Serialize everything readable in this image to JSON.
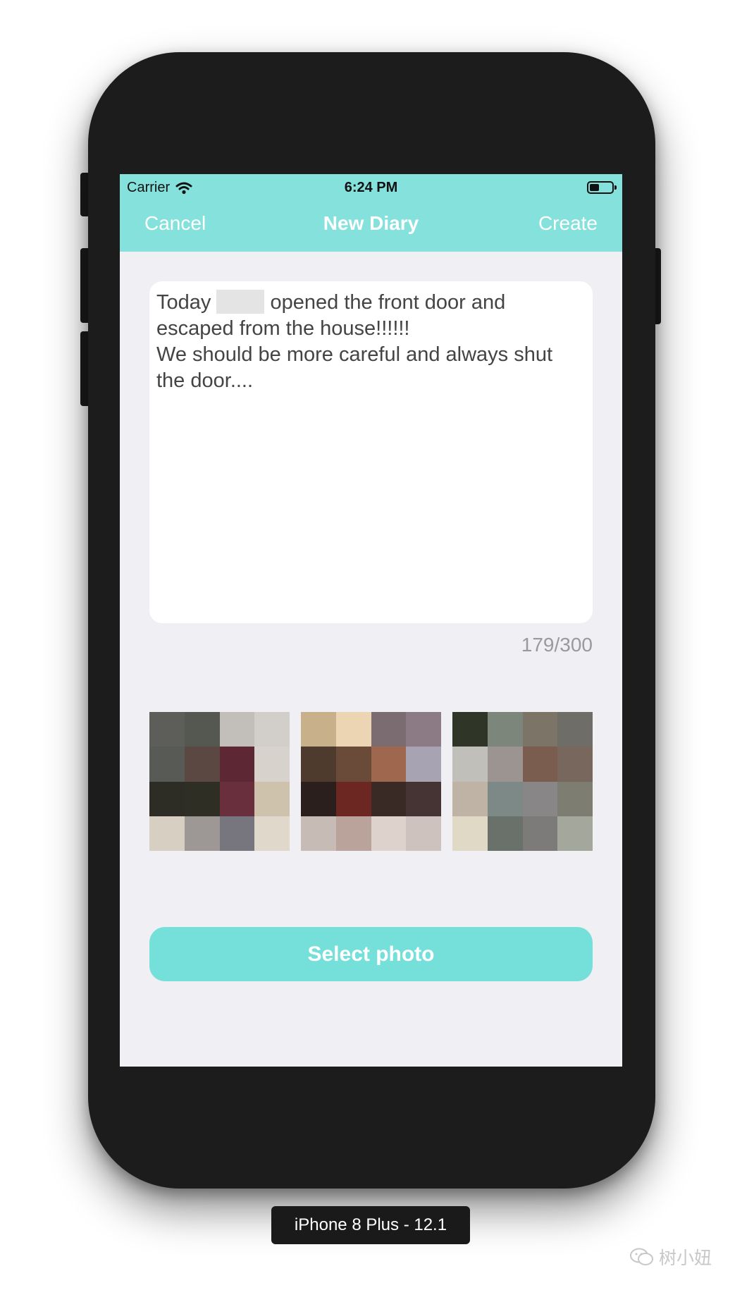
{
  "status_bar": {
    "carrier": "Carrier",
    "time": "6:24 PM"
  },
  "nav": {
    "cancel_label": "Cancel",
    "title": "New Diary",
    "create_label": "Create"
  },
  "editor": {
    "text_before": "Today ",
    "text_after": " opened the front door and escaped from the house!!!!!!\nWe should be more careful and always shut the door....",
    "counter": "179/300"
  },
  "photos": [
    {
      "colors": [
        "#5d5d5a",
        "#555851",
        "#c2bfba",
        "#d2cfca",
        "#575a55",
        "#5b4843",
        "#5e2734",
        "#d8d2cc",
        "#2e2d25",
        "#2f2e24",
        "#6a2f3d",
        "#cfc2ac",
        "#d7cfc2",
        "#9d9896",
        "#77767f",
        "#e0d8cb"
      ]
    },
    {
      "colors": [
        "#c8b08b",
        "#ebd5b3",
        "#7b6c72",
        "#8c7b85",
        "#4e3b2d",
        "#6a4b3a",
        "#a0674f",
        "#a7a3b2",
        "#2b1f1d",
        "#6c2723",
        "#3a2a26",
        "#463434",
        "#c6bbb5",
        "#b9a39b",
        "#ddd3cc",
        "#cdc2bd"
      ]
    },
    {
      "colors": [
        "#2f3527",
        "#7d867b",
        "#7b7467",
        "#6e6d68",
        "#c0bfb9",
        "#9c9491",
        "#7b5d4f",
        "#77675c",
        "#bfb3a5",
        "#7d8986",
        "#898688",
        "#7e7d71",
        "#e0d9c5",
        "#6a716b",
        "#7c7b79",
        "#a3a79c"
      ]
    }
  ],
  "select_photo_label": "Select photo",
  "device_label": "iPhone 8 Plus - 12.1",
  "watermark": "树小妞"
}
